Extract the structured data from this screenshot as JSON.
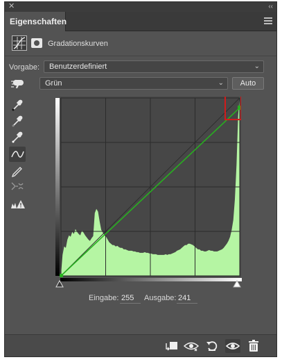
{
  "window": {
    "close_glyph": "✕",
    "collapse_glyph": "‹‹"
  },
  "panel": {
    "tab_label": "Eigenschaften"
  },
  "header": {
    "title": "Gradationskurven"
  },
  "preset": {
    "label": "Vorgabe:",
    "value": "Benutzerdefiniert"
  },
  "channel": {
    "value": "Grün",
    "auto_label": "Auto"
  },
  "tools": [
    "hand-target-icon",
    "black-point-eyedropper-icon",
    "gray-point-eyedropper-icon",
    "white-point-eyedropper-icon",
    "curve-points-icon",
    "pencil-icon",
    "smooth-icon",
    "clipping-warning-icon"
  ],
  "chart_data": {
    "type": "line",
    "title": "",
    "xlabel": "",
    "ylabel": "",
    "xlim": [
      0,
      255
    ],
    "ylim": [
      0,
      255
    ],
    "grid": true,
    "series": [
      {
        "values": [
          [
            0,
            0
          ],
          [
            255,
            241
          ]
        ],
        "color": "#27b11f"
      }
    ],
    "histogram": {
      "color": "#b5f5a3",
      "values": [
        2,
        30,
        42,
        40,
        52,
        58,
        56,
        63,
        60,
        67,
        63,
        60,
        58,
        65,
        62,
        58,
        55,
        52,
        50,
        54,
        57,
        90,
        96,
        92,
        78,
        66,
        62,
        58,
        56,
        52,
        48,
        46,
        44,
        44,
        42,
        43,
        41,
        40,
        40,
        38,
        38,
        37,
        36,
        36,
        36,
        35,
        35,
        34,
        34,
        33,
        33,
        33,
        34,
        33,
        33,
        32,
        32,
        31,
        31,
        31,
        30,
        30,
        30,
        30,
        30,
        31,
        30,
        31,
        31,
        32,
        33,
        34,
        36,
        37,
        38,
        40,
        42,
        44,
        44,
        46,
        46,
        45,
        44,
        42,
        40,
        38,
        38,
        36,
        36,
        35,
        35,
        36,
        37,
        36,
        36,
        35,
        35,
        35,
        36,
        37,
        38,
        40,
        43,
        46,
        50,
        56,
        66,
        80,
        110,
        160,
        230,
        258
      ]
    },
    "endpoint_highlight": {
      "x": 255,
      "y": 241,
      "color": "#d21b1b"
    }
  },
  "io": {
    "input_label": "Eingabe:",
    "input_value": "255",
    "output_label": "Ausgabe:",
    "output_value": "241"
  },
  "footer": [
    "clip-to-layer-icon",
    "view-previous-state-icon",
    "reset-icon",
    "visibility-eye-icon",
    "delete-trash-icon"
  ]
}
